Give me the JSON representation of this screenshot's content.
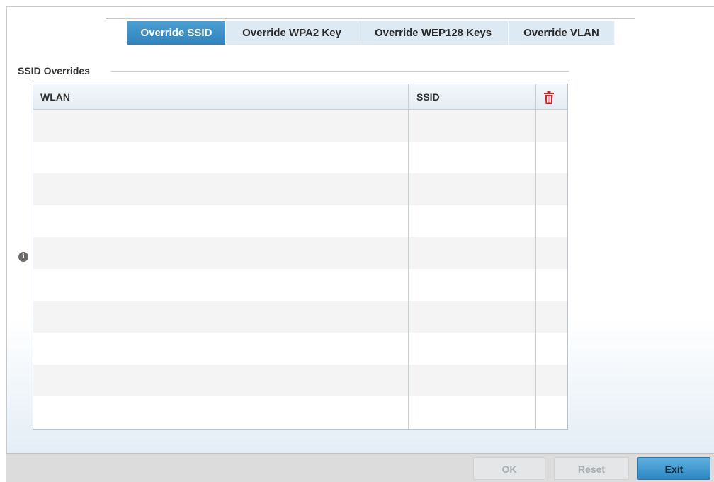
{
  "tabs": [
    {
      "label": "Override SSID",
      "active": true
    },
    {
      "label": "Override WPA2 Key",
      "active": false
    },
    {
      "label": "Override WEP128 Keys",
      "active": false
    },
    {
      "label": "Override VLAN",
      "active": false
    }
  ],
  "section": {
    "title": "SSID Overrides",
    "info_icon": "info-icon"
  },
  "table": {
    "columns": [
      "WLAN",
      "SSID"
    ],
    "delete_icon": "trash-icon",
    "row_count_visible": 10,
    "rows": []
  },
  "footer": {
    "ok_label": "OK",
    "reset_label": "Reset",
    "exit_label": "Exit"
  },
  "colors": {
    "accent": "#2f83bd",
    "tab_inactive": "#dde9f3",
    "delete_icon": "#c8262c",
    "disabled_text": "#a8aeb2"
  }
}
